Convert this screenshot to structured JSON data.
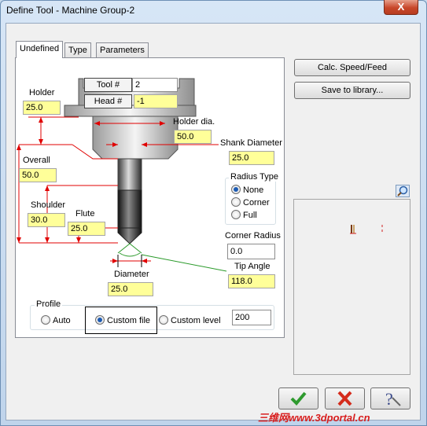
{
  "window": {
    "title": "Define Tool - Machine Group-2",
    "close_glyph": "X"
  },
  "tabs": [
    {
      "label": "Undefined"
    },
    {
      "label": "Type"
    },
    {
      "label": "Parameters"
    }
  ],
  "header": {
    "tool_label": "Tool #",
    "tool_value": "2",
    "head_label": "Head #",
    "head_value": "-1"
  },
  "fields": {
    "holder": {
      "label": "Holder",
      "value": "25.0"
    },
    "holder_dia": {
      "label": "Holder dia.",
      "value": "50.0"
    },
    "shank_diameter": {
      "label": "Shank Diameter",
      "value": "25.0"
    },
    "overall": {
      "label": "Overall",
      "value": "50.0"
    },
    "shoulder": {
      "label": "Shoulder",
      "value": "30.0"
    },
    "flute": {
      "label": "Flute",
      "value": "25.0"
    },
    "diameter": {
      "label": "Diameter",
      "value": "25.0"
    },
    "corner_radius": {
      "label": "Corner Radius",
      "value": "0.0"
    },
    "tip_angle": {
      "label": "Tip Angle",
      "value": "118.0"
    }
  },
  "radius_type": {
    "label": "Radius Type",
    "options": [
      "None",
      "Corner",
      "Full"
    ],
    "selected": "None"
  },
  "profile": {
    "label": "Profile",
    "options": [
      "Auto",
      "Custom file",
      "Custom level"
    ],
    "selected": "Custom file",
    "level_value": "200"
  },
  "side_buttons": {
    "calc": "Calc. Speed/Feed",
    "save": "Save to library..."
  },
  "footer_icons": [
    "ok-checkmark-icon",
    "cancel-x-icon",
    "help-question-icon"
  ],
  "watermark": "三维网www.3dportal.cn",
  "colors": {
    "field_bg": "#ffff99",
    "dimension_red": "#e00000",
    "ok_green": "#2e9a2e",
    "cancel_red": "#d42b1b"
  }
}
